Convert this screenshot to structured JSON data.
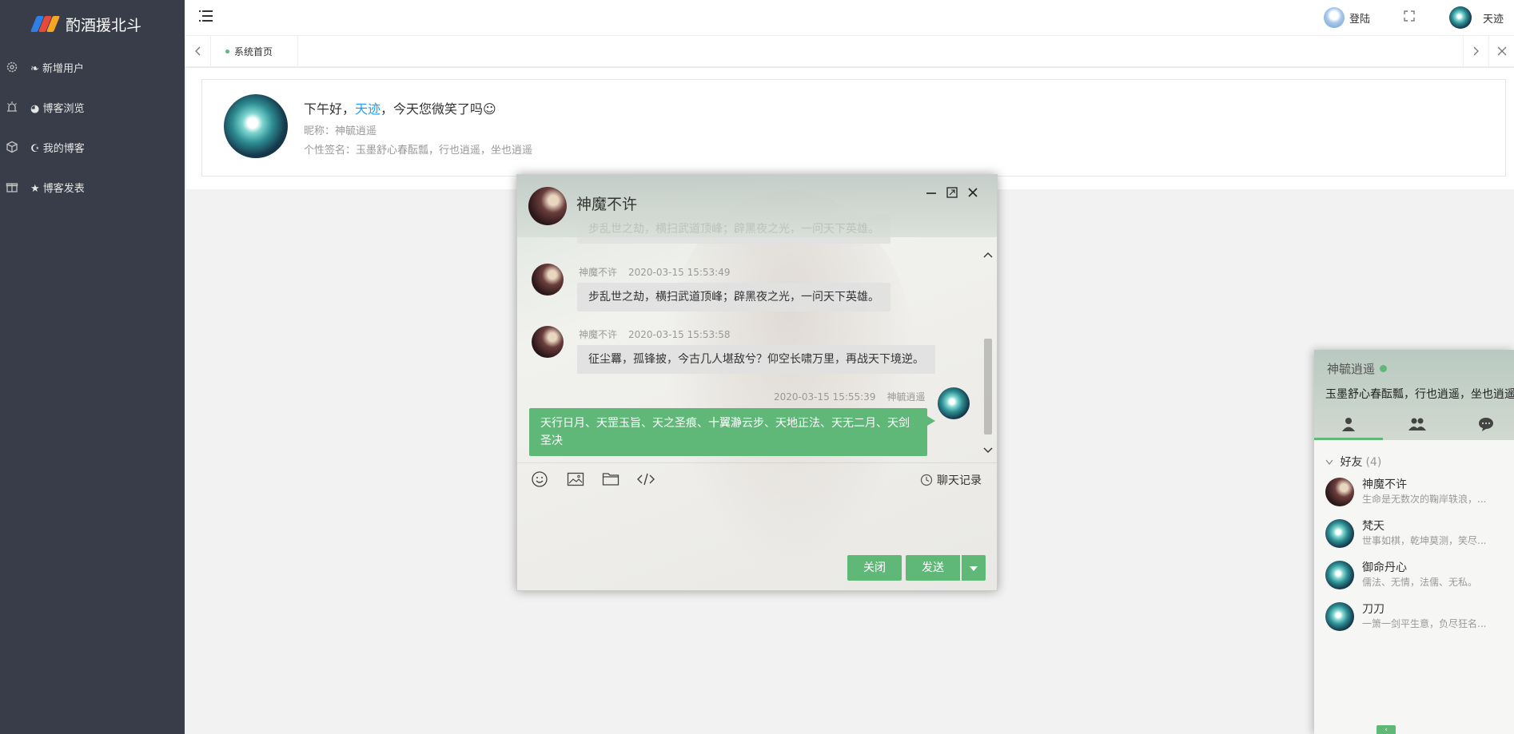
{
  "app": {
    "title": "酌酒援北斗"
  },
  "colors": {
    "sidebar": "#393d49",
    "accent": "#5fb878",
    "link": "#1e9fff"
  },
  "sidebar": {
    "items": [
      {
        "label": "❧ 新增用户",
        "icon": "gear-icon"
      },
      {
        "label": "◕ 博客浏览",
        "icon": "alarm-icon"
      },
      {
        "label": "☪ 我的博客",
        "icon": "cube-icon"
      },
      {
        "label": "★ 博客发表",
        "icon": "gift-icon"
      }
    ]
  },
  "header": {
    "login_label": "登陆",
    "user_name": "天迹"
  },
  "tabs": [
    {
      "label": "系统首页"
    }
  ],
  "welcome": {
    "greeting_prefix": "下午好，",
    "user": "天迹",
    "greeting_suffix": "，今天您微笑了吗☺",
    "nickname": "昵称：神毓逍遥",
    "signature": "个性签名：玉墨舒心春酝瓢，行也逍遥，坐也逍遥"
  },
  "chat": {
    "title": "神魔不许",
    "partial_message": "步乱世之劫，横扫武道顶峰；辟黑夜之光，一问天下英雄。",
    "messages": [
      {
        "sender": "神魔不许",
        "time": "2020-03-15 15:53:49",
        "text": "步乱世之劫，横扫武道顶峰；辟黑夜之光，一问天下英雄。"
      },
      {
        "sender": "神魔不许",
        "time": "2020-03-15 15:53:58",
        "text": "征尘羃，孤锋披，今古几人堪敌兮？仰空长啸万里，再战天下境逆。"
      }
    ],
    "self_message": {
      "sender": "神毓逍遥",
      "time": "2020-03-15 15:55:39",
      "text": "天行日月、天罡玉旨、天之圣痕、十翼瀞云步、天地正法、天无二月、天剑圣决"
    },
    "history_label": "聊天记录",
    "close_label": "关闭",
    "send_label": "发送"
  },
  "panel": {
    "name": "神毓逍遥",
    "signature": "玉墨舒心春酝瓢，行也逍遥，坐也逍遥",
    "group": {
      "title": "好友",
      "count": "(4)"
    },
    "friends": [
      {
        "name": "神魔不许",
        "sign": "生命是无数次的鞠岸轶浪，..."
      },
      {
        "name": "梵天",
        "sign": "世事如棋，乾坤莫测，笑尽..."
      },
      {
        "name": "御命丹心",
        "sign": "儒法、无情，法儒、无私。"
      },
      {
        "name": "刀刀",
        "sign": "一箫一剑平生意，负尽狂名..."
      }
    ]
  }
}
